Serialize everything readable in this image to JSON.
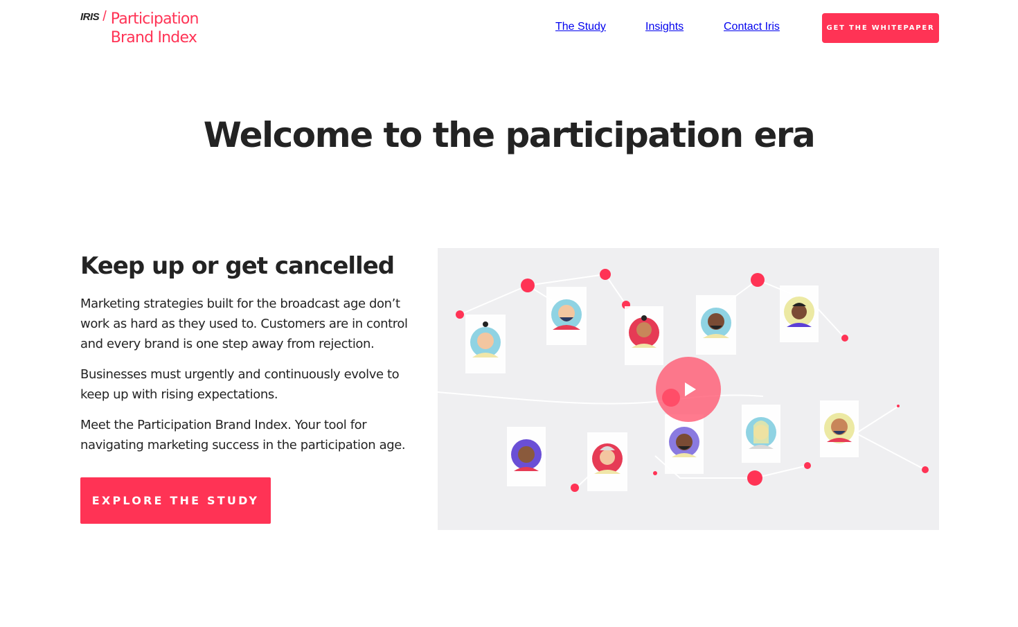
{
  "header": {
    "logo_prefix": "IRIS",
    "logo_slash": "/",
    "logo_line1": "Participation",
    "logo_line2": "Brand Index",
    "nav": {
      "study": "The Study",
      "insights": "Insights",
      "contact": "Contact Iris"
    },
    "cta_label": "GET THE WHITEPAPER"
  },
  "hero": {
    "title": "Welcome to the participation era"
  },
  "intro": {
    "heading": "Keep up or get cancelled",
    "paragraph1": "Marketing strategies built for the broadcast age don’t work as hard as they used to. Customers are in control and every brand is one step away from rejection.",
    "paragraph2": "Businesses must urgently and continuously evolve to keep up with rising expectations.",
    "paragraph3": "Meet the Participation Brand Index. Your tool for navigating marketing success in the participation age.",
    "cta_label": "EXPLORE THE STUDY"
  },
  "video": {
    "play_icon": "play-icon",
    "accent_color": "#ff3355"
  },
  "colors": {
    "brand": "#ff3355",
    "text": "#232323",
    "video_bg": "#efeff1"
  }
}
